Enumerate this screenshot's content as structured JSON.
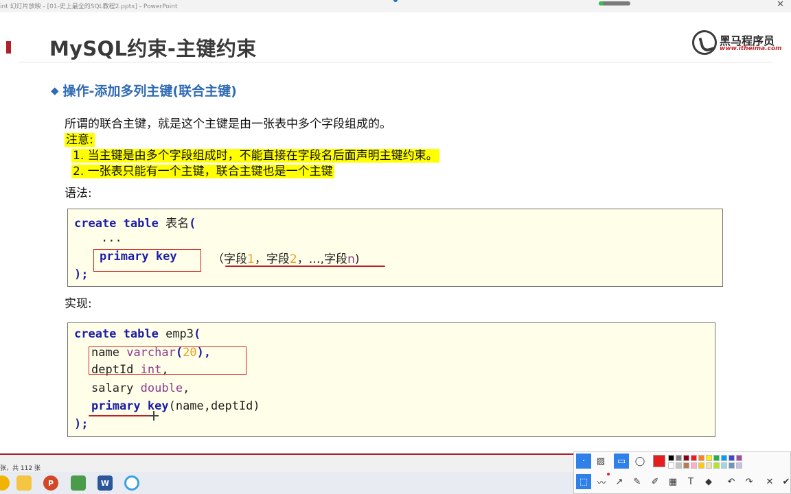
{
  "window": {
    "title": "int 幻灯片放映 - [01-史上最全的SQL教程2.pptx] - PowerPoint",
    "close_symbol": "✕"
  },
  "slide": {
    "title": "MySQL约束-主键约束",
    "logo": {
      "cn": "黑马程序员",
      "url": "www.itheima.com"
    },
    "section_bullet": "◆",
    "section_heading": "操作-添加多列主键(联合主键)",
    "intro": "所谓的联合主键，就是这个主键是由一张表中多个字段组成的。",
    "note_label": "注意:",
    "notes": [
      "1. 当主键是由多个字段组成时，不能直接在字段名后面声明主键约束。",
      "2. 一张表只能有一个主键，联合主键也是一个主键"
    ],
    "syntax_label": "语法:",
    "syntax_code": {
      "line1_kw": "create table",
      "line1_name": "表名",
      "line1_paren": "(",
      "line2": "...",
      "line3_kw": "primary key",
      "line3_fields": {
        "open": "（",
        "field": "字段",
        "n1": "1",
        "sep1": "，",
        "n2": "2",
        "sep2": "，…,",
        "nn": "n",
        "close": ")"
      },
      "line4": ");"
    },
    "impl_label": "实现:",
    "impl_code": {
      "line1_kw": "create table",
      "line1_name": "emp3",
      "line1_paren": "(",
      "line2_name": "name",
      "line2_type": "varchar",
      "line2_open": "(",
      "line2_num": "20",
      "line2_close": "),",
      "line3_name": "deptId",
      "line3_type": "int",
      "line3_comma": ",",
      "line4_name": "salary",
      "line4_type": "double",
      "line4_comma": ",",
      "line5_kw": "primary key",
      "line5_args": "(name,deptId)",
      "line6": ");"
    }
  },
  "statusbar": {
    "text": "张，共 112 张"
  },
  "taskbar": {
    "icons": [
      "chrome-icon",
      "folder-icon",
      "powerpoint-icon",
      "photo-icon",
      "word-icon",
      "browser-icon"
    ],
    "ppt_letter": "P",
    "word_letter": "W"
  },
  "drawing_toolbar": {
    "symbols": {
      "pointer": "·",
      "hatch": "▨",
      "rect": "▭",
      "ellipse": "◯",
      "select": "⬚",
      "polyline": "〰",
      "arrow": "↗",
      "pen": "✎",
      "marker": "✐",
      "mosaic": "▦",
      "text": "T",
      "eraser": "◆",
      "undo": "↶",
      "redo": "↷",
      "close": "✕",
      "pin": "✔"
    },
    "colors": {
      "current": "#e41e1e",
      "row1": [
        "#000000",
        "#7f7f7f",
        "#880015",
        "#ed1c24",
        "#ff7f27",
        "#fff200",
        "#22b14c",
        "#00a2e8",
        "#3f48cc",
        "#a349a4"
      ],
      "row2": [
        "#ffffff",
        "#c3c3c3",
        "#b97a57",
        "#ffaec9",
        "#ffc90e",
        "#efe4b0",
        "#b5e61d",
        "#99d9ea",
        "#7092be",
        "#c8bfe7"
      ]
    }
  }
}
